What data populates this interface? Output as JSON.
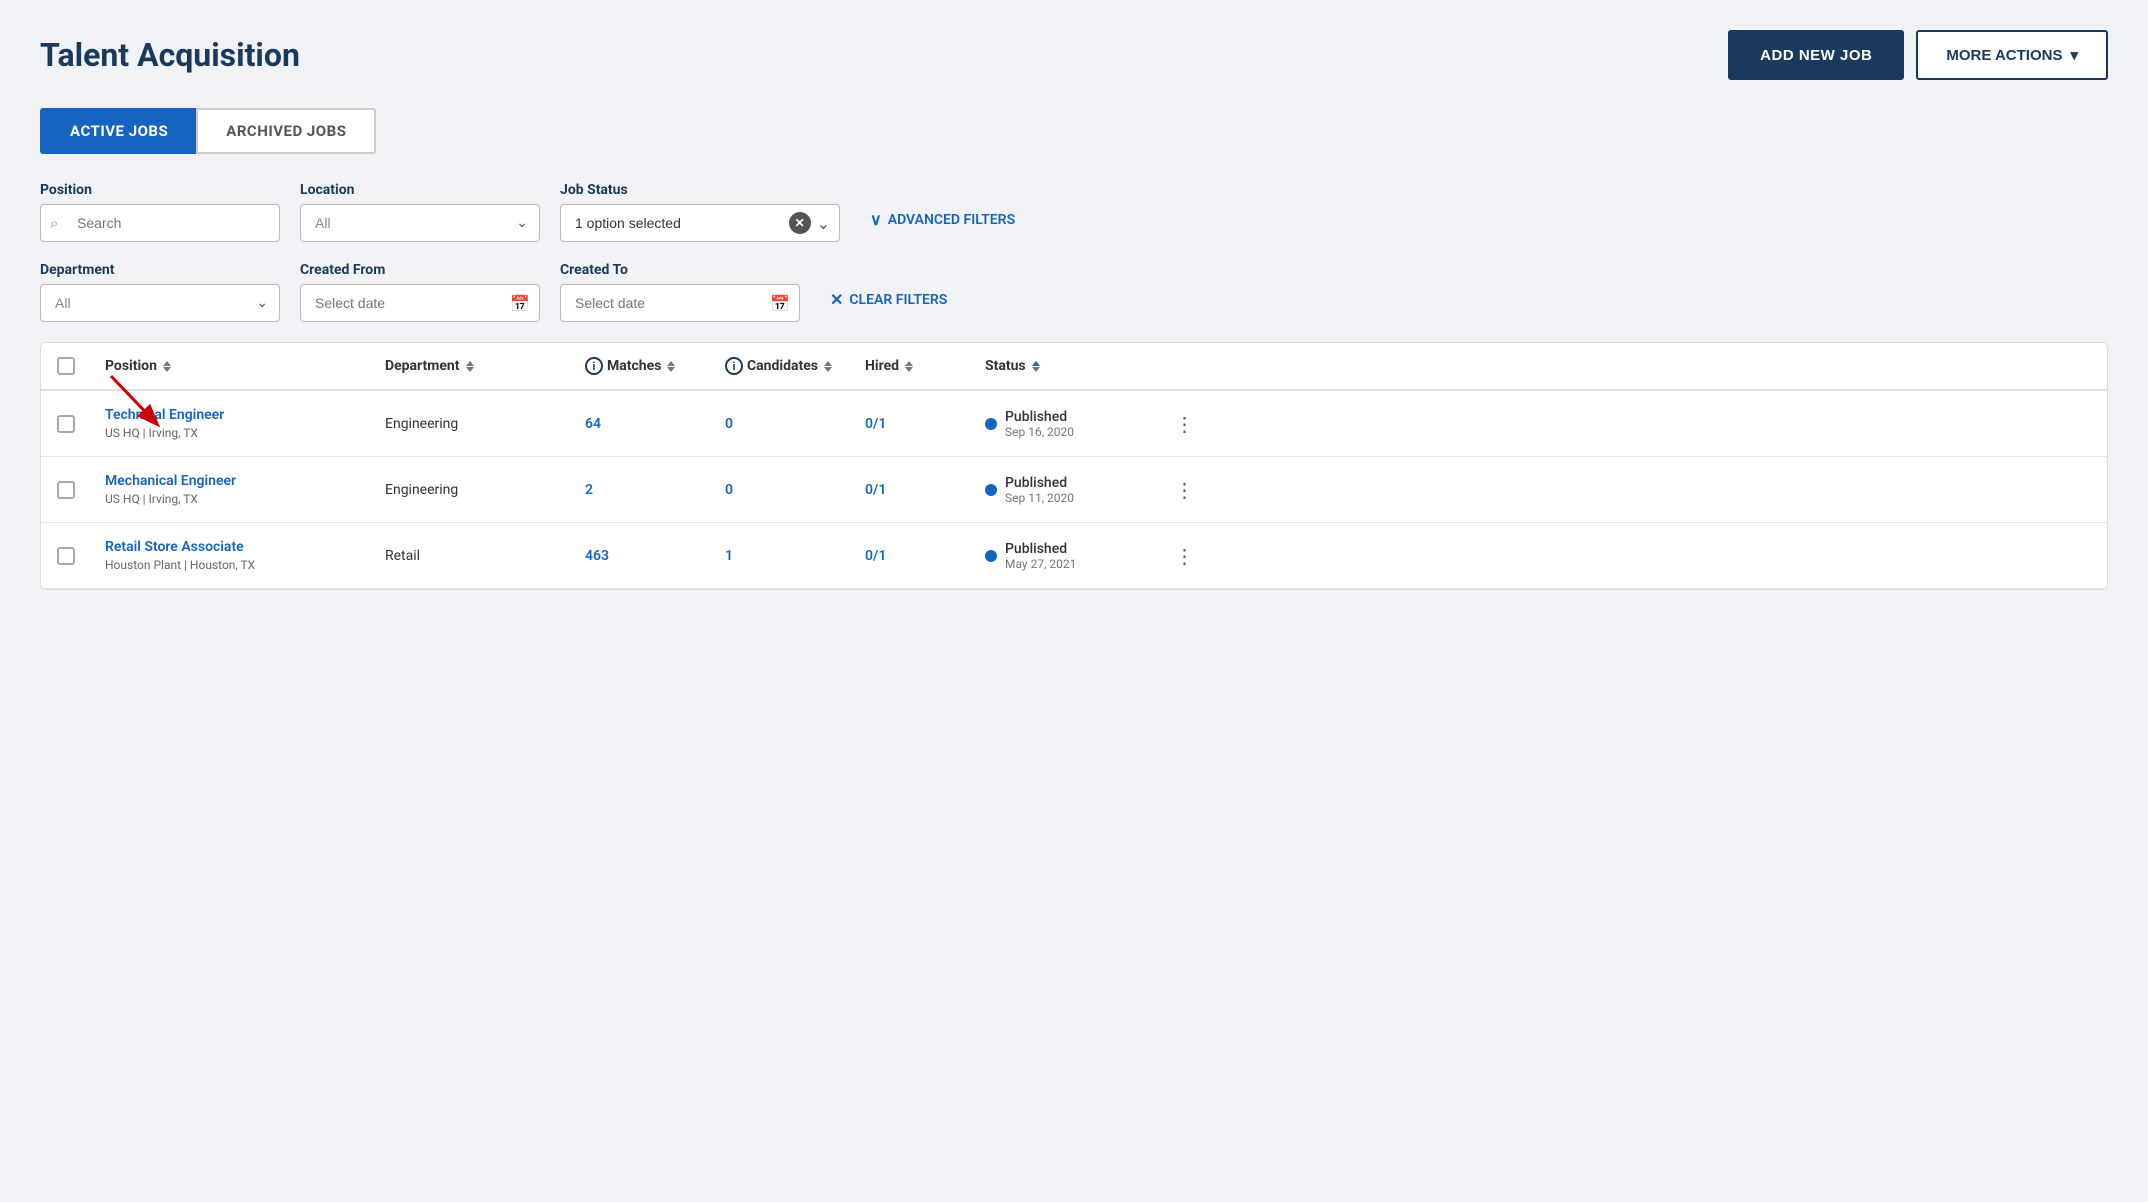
{
  "page": {
    "title": "Talent Acquisition"
  },
  "header": {
    "add_job_label": "ADD NEW JOB",
    "more_actions_label": "MORE ACTIONS"
  },
  "tabs": [
    {
      "id": "active",
      "label": "ACTIVE JOBS",
      "active": true
    },
    {
      "id": "archived",
      "label": "ARCHIVED JOBS",
      "active": false
    }
  ],
  "filters": {
    "position_label": "Position",
    "position_placeholder": "Search",
    "location_label": "Location",
    "location_value": "All",
    "job_status_label": "Job Status",
    "job_status_value": "1 option selected",
    "advanced_filters_label": "ADVANCED FILTERS",
    "department_label": "Department",
    "department_value": "All",
    "created_from_label": "Created From",
    "created_from_placeholder": "Select date",
    "created_to_label": "Created To",
    "created_to_placeholder": "Select date",
    "clear_filters_label": "CLEAR FILTERS"
  },
  "table": {
    "columns": [
      {
        "id": "checkbox",
        "label": ""
      },
      {
        "id": "position",
        "label": "Position",
        "sortable": true
      },
      {
        "id": "department",
        "label": "Department",
        "sortable": true
      },
      {
        "id": "matches",
        "label": "Matches",
        "sortable": true,
        "info": true
      },
      {
        "id": "candidates",
        "label": "Candidates",
        "sortable": true,
        "info": true
      },
      {
        "id": "hired",
        "label": "Hired",
        "sortable": true
      },
      {
        "id": "status",
        "label": "Status",
        "sortable": true,
        "sort_dir": "asc"
      },
      {
        "id": "actions",
        "label": ""
      }
    ],
    "rows": [
      {
        "id": 1,
        "position_name": "Technical Engineer",
        "position_location": "US HQ  |  Irving, TX",
        "department": "Engineering",
        "matches": "64",
        "candidates": "0",
        "hired": "0/1",
        "status_label": "Published",
        "status_date": "Sep 16, 2020",
        "status_type": "published"
      },
      {
        "id": 2,
        "position_name": "Mechanical Engineer",
        "position_location": "US HQ  |  Irving, TX",
        "department": "Engineering",
        "matches": "2",
        "candidates": "0",
        "hired": "0/1",
        "status_label": "Published",
        "status_date": "Sep 11, 2020",
        "status_type": "published"
      },
      {
        "id": 3,
        "position_name": "Retail Store Associate",
        "position_location": "Houston Plant  |  Houston, TX",
        "department": "Retail",
        "matches": "463",
        "candidates": "1",
        "hired": "0/1",
        "status_label": "Published",
        "status_date": "May 27, 2021",
        "status_type": "published"
      }
    ]
  }
}
